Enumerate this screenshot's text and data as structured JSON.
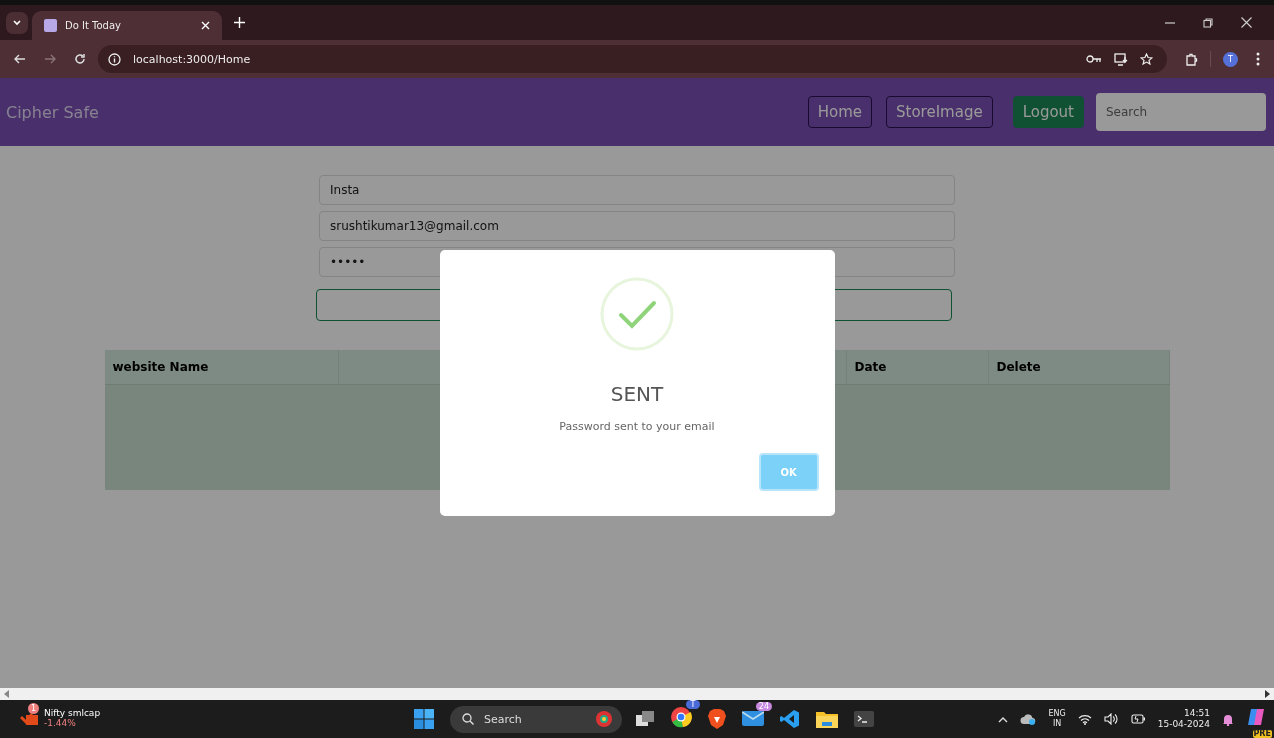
{
  "browser": {
    "tab_title": "Do It Today",
    "url": "localhost:3000/Home",
    "profile_initial": "T"
  },
  "navbar": {
    "brand": "Cipher Safe",
    "links": [
      {
        "label": "Home",
        "kind": "outline"
      },
      {
        "label": "StoreImage",
        "kind": "outline"
      },
      {
        "label": "Logout",
        "kind": "solid"
      }
    ],
    "search": {
      "placeholder": "Search"
    }
  },
  "form": {
    "fields": [
      {
        "value": "Insta"
      },
      {
        "value": "srushtikumar13@gmail.com"
      },
      {
        "value": "•••••"
      }
    ]
  },
  "table": {
    "columns": [
      "website Name",
      "Date",
      "Delete"
    ]
  },
  "dialog": {
    "title": "SENT",
    "message": "Password sent to your email",
    "button": "OK"
  },
  "taskbar": {
    "widget": {
      "name": "Nifty smlcap",
      "change": "-1.44%",
      "badge": "1"
    },
    "search": {
      "placeholder": "Search"
    },
    "mail_badge": "24",
    "chrome_badge": "T",
    "language": "ENG",
    "region": "IN",
    "time": "14:51",
    "date": "15-04-2024",
    "copilot_badge": "PRE"
  }
}
